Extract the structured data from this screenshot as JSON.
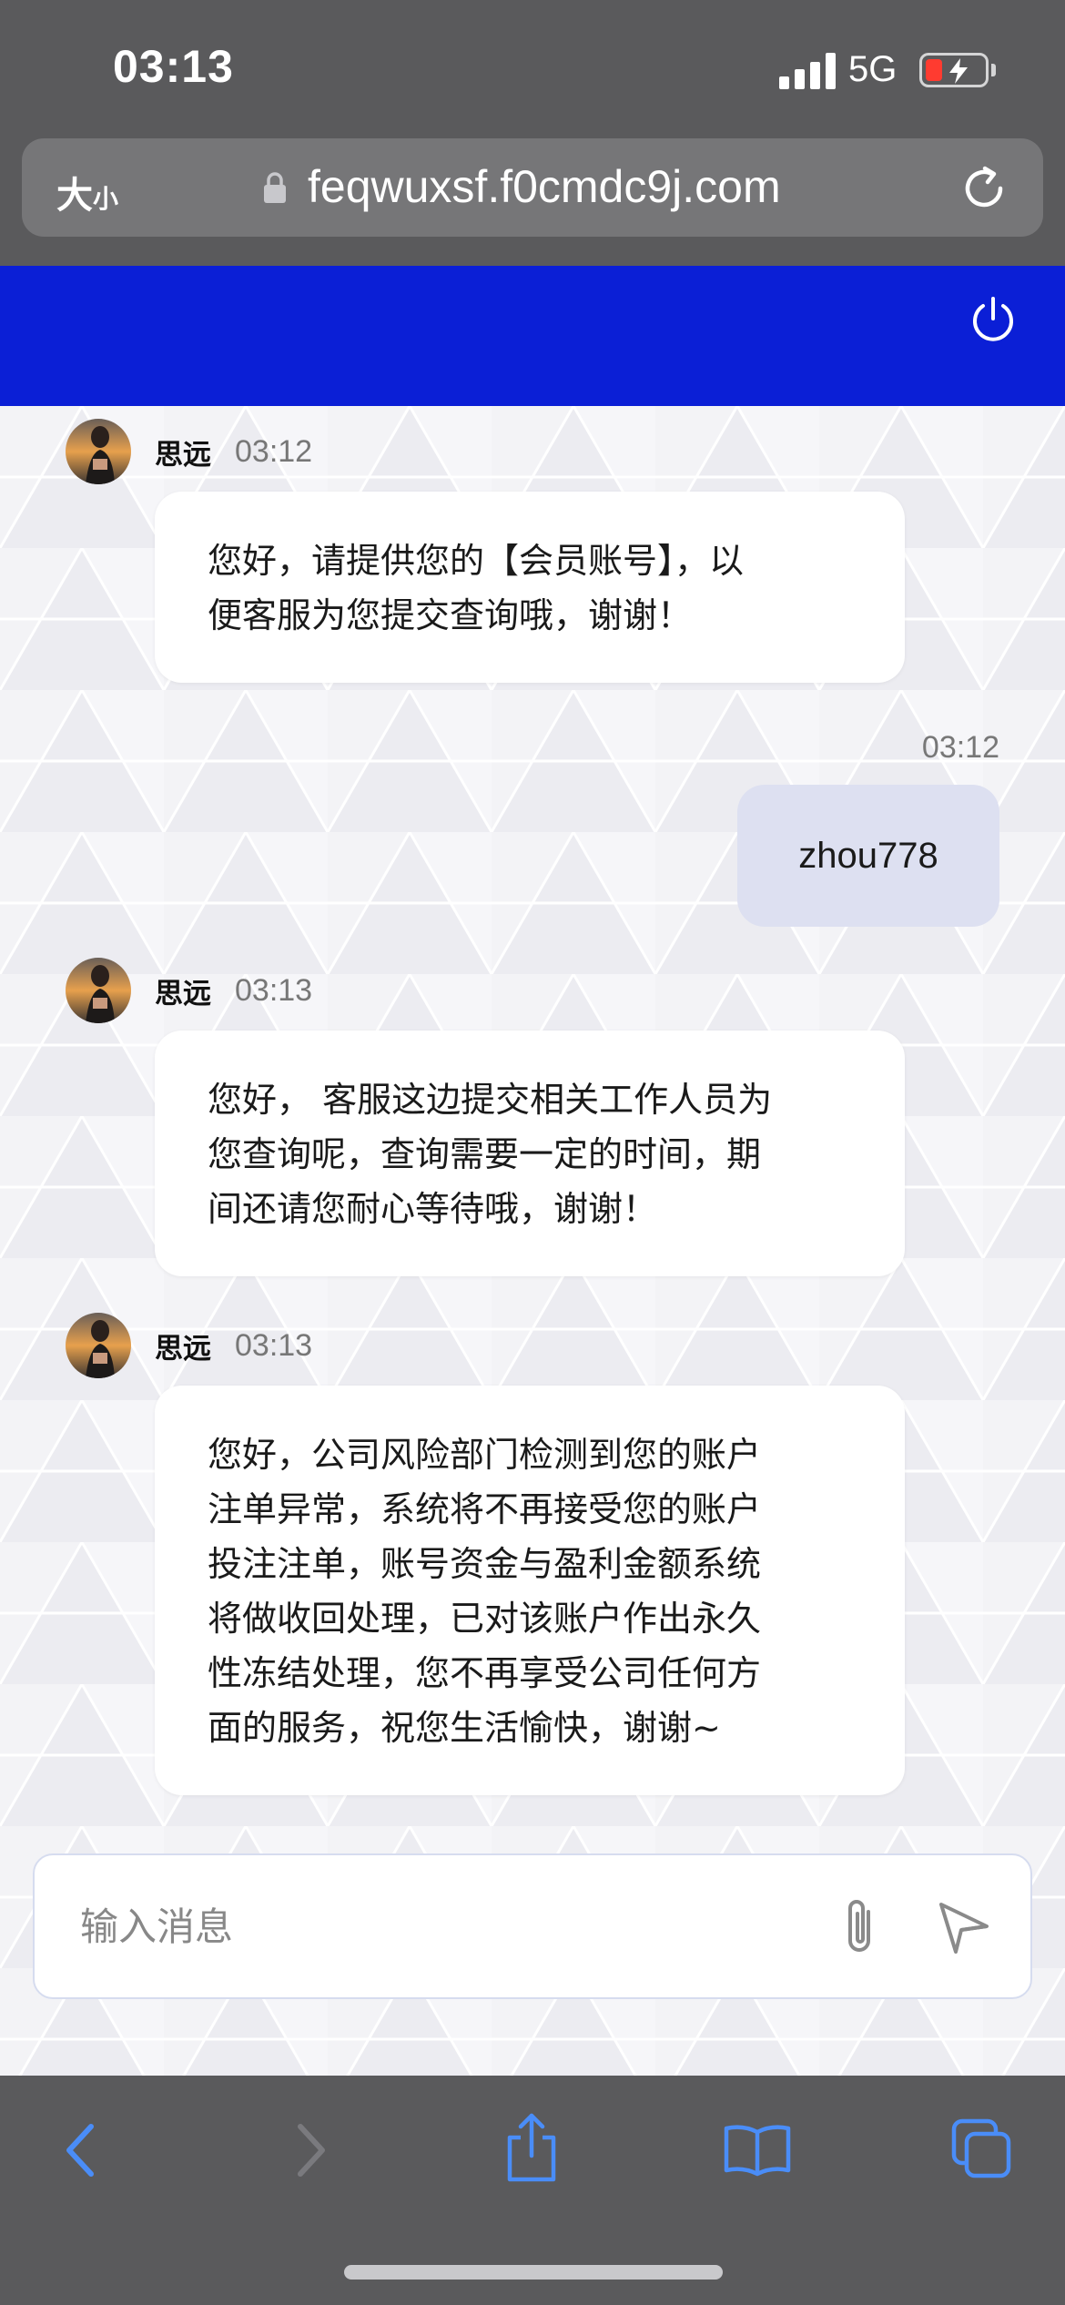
{
  "status_bar": {
    "time": "03:13",
    "network": "5G"
  },
  "browser": {
    "text_size_big": "大",
    "text_size_small": "小",
    "url": "feqwuxsf.f0cmdc9j.com"
  },
  "chat": {
    "messages": [
      {
        "sender": "思远",
        "time": "03:12",
        "lines": [
          "您好，请提供您的【会员账号】，以",
          "便客服为您提交查询哦，谢谢！"
        ]
      },
      {
        "user_time": "03:12",
        "user_text": "zhou778"
      },
      {
        "sender": "思远",
        "time": "03:13",
        "lines": [
          "您好， 客服这边提交相关工作人员为",
          "您查询呢，查询需要一定的时间，期",
          "间还请您耐心等待哦，谢谢！"
        ]
      },
      {
        "sender": "思远",
        "time": "03:13",
        "lines": [
          "您好，公司风险部门检测到您的账户",
          "注单异常，系统将不再接受您的账户",
          "投注注单，账号资金与盈利金额系统",
          "将做收回处理，已对该账户作出永久",
          "性冻结处理，您不再享受公司任何方",
          "面的服务，祝您生活愉快，谢谢~"
        ]
      }
    ]
  },
  "input": {
    "placeholder": "输入消息",
    "value": ""
  },
  "colors": {
    "header": "#0b1fd6",
    "user_bubble": "#dde0f1",
    "toolbar_icon": "#4a8df8"
  },
  "icons": [
    "lock-icon",
    "reload-icon",
    "power-icon",
    "attach-icon",
    "send-icon",
    "back-icon",
    "forward-icon",
    "share-icon",
    "bookmarks-icon",
    "tabs-icon"
  ]
}
